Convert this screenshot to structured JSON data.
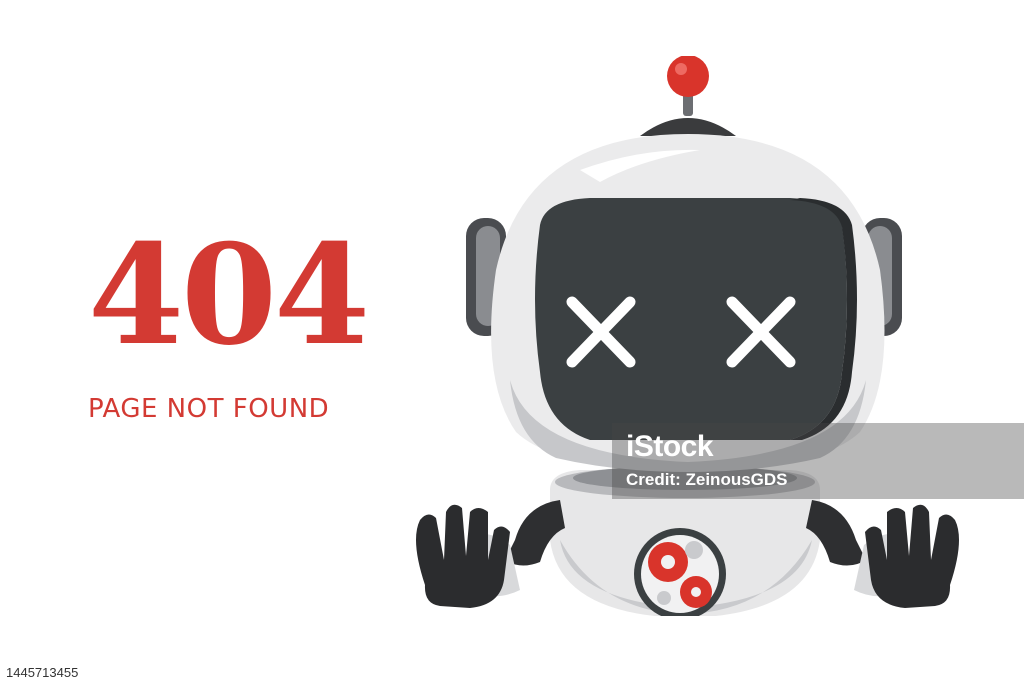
{
  "error": {
    "code": "404",
    "message": "PAGE NOT FOUND"
  },
  "illustration": {
    "subject": "robot-with-x-eyes"
  },
  "watermark": {
    "brand": "iStock",
    "credit": "Credit: ZeinousGDS"
  },
  "stock_id": "1445713455",
  "colors": {
    "accent": "#d33a33",
    "robot_body": "#e9e9ea",
    "robot_screen": "#3b4042",
    "robot_dark": "#3a3b3d",
    "antenna_ball": "#d9342b"
  }
}
